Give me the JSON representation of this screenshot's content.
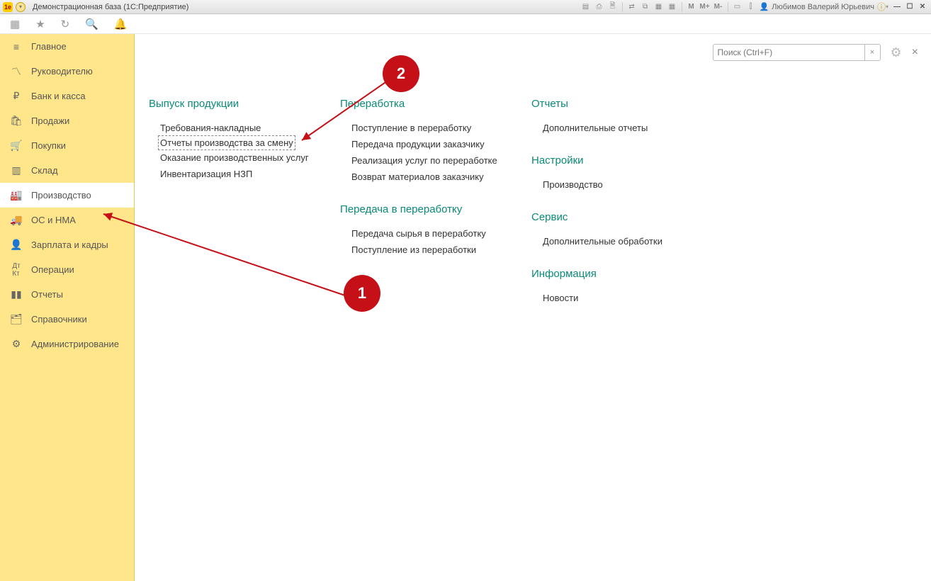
{
  "titlebar": {
    "logo_text": "1e",
    "title": "Демонстрационная база  (1С:Предприятие)",
    "user_name": "Любимов Валерий Юрьевич",
    "m_btn": "M",
    "mplus": "M+",
    "mminus": "M-"
  },
  "search": {
    "placeholder": "Поиск (Ctrl+F)"
  },
  "sidebar": {
    "items": [
      {
        "label": "Главное"
      },
      {
        "label": "Руководителю"
      },
      {
        "label": "Банк и касса"
      },
      {
        "label": "Продажи"
      },
      {
        "label": "Покупки"
      },
      {
        "label": "Склад"
      },
      {
        "label": "Производство"
      },
      {
        "label": "ОС и НМА"
      },
      {
        "label": "Зарплата и кадры"
      },
      {
        "label": "Операции"
      },
      {
        "label": "Отчеты"
      },
      {
        "label": "Справочники"
      },
      {
        "label": "Администрирование"
      }
    ]
  },
  "columns": {
    "col1": {
      "g1_title": "Выпуск продукции",
      "g1_links": [
        "Требования-накладные",
        "Отчеты производства за смену",
        "Оказание производственных услуг",
        "Инвентаризация НЗП"
      ]
    },
    "col2": {
      "g1_title": "Переработка",
      "g1_links": [
        "Поступление в переработку",
        "Передача продукции заказчику",
        "Реализация услуг по переработке",
        "Возврат материалов заказчику"
      ],
      "g2_title": "Передача в переработку",
      "g2_links": [
        "Передача сырья в переработку",
        "Поступление из переработки"
      ]
    },
    "col3": {
      "g1_title": "Отчеты",
      "g1_links": [
        "Дополнительные отчеты"
      ],
      "g2_title": "Настройки",
      "g2_links": [
        "Производство"
      ],
      "g3_title": "Сервис",
      "g3_links": [
        "Дополнительные обработки"
      ],
      "g4_title": "Информация",
      "g4_links": [
        "Новости"
      ]
    }
  },
  "annotations": {
    "badge1": "1",
    "badge2": "2"
  }
}
